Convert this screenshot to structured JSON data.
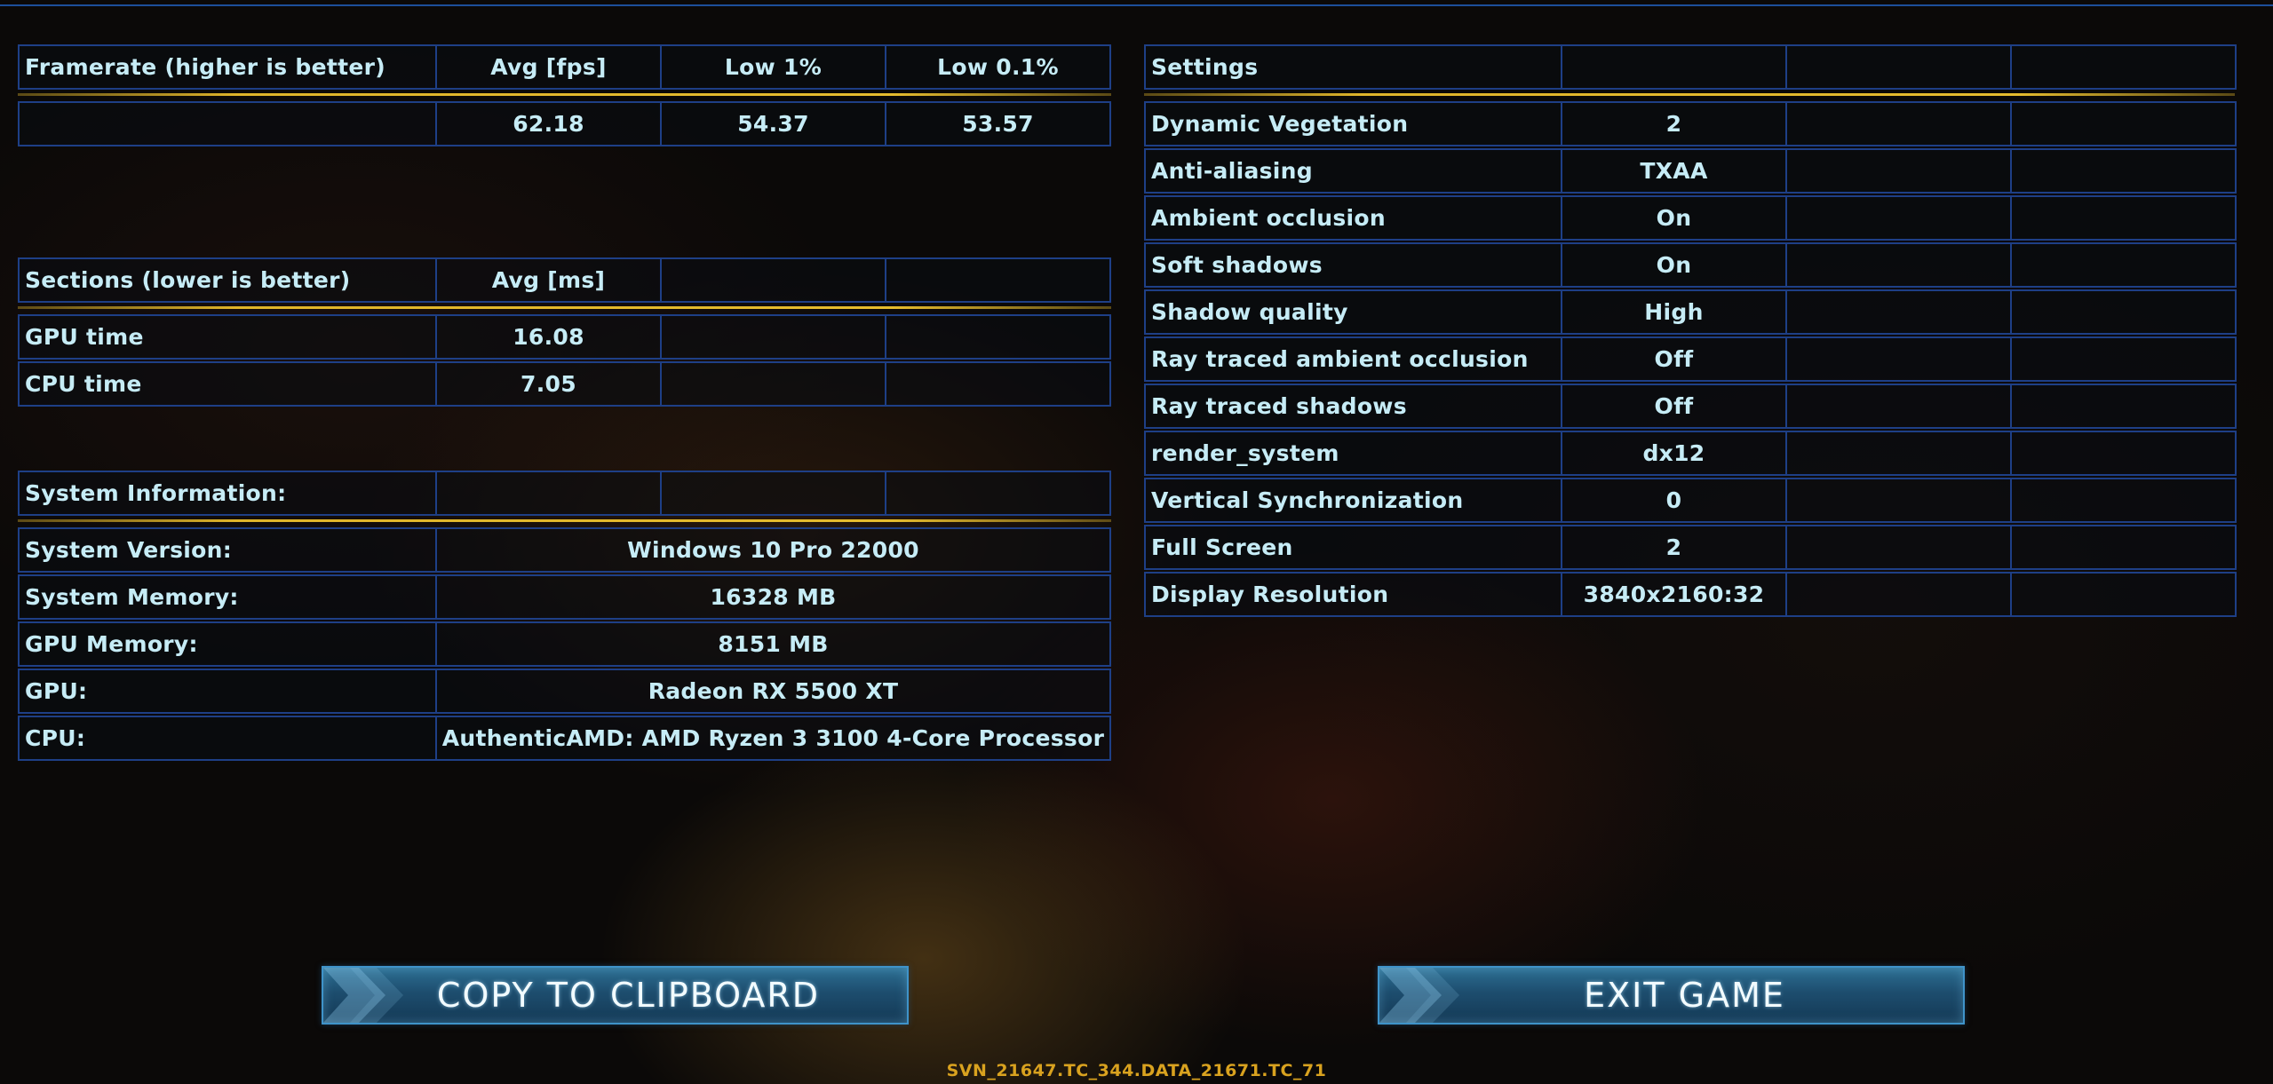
{
  "framerate": {
    "headers": [
      "Framerate (higher is better)",
      "Avg [fps]",
      "Low 1%",
      "Low 0.1%"
    ],
    "values": [
      "",
      "62.18",
      "54.37",
      "53.57"
    ]
  },
  "sections": {
    "headers": [
      "Sections (lower is better)",
      "Avg [ms]",
      "",
      ""
    ],
    "rows": [
      {
        "label": "GPU time",
        "value": "16.08"
      },
      {
        "label": "CPU time",
        "value": "7.05"
      }
    ]
  },
  "system_info": {
    "title": "System Information:",
    "rows": [
      {
        "label": "System Version:",
        "value": "Windows 10 Pro 22000"
      },
      {
        "label": "System Memory:",
        "value": "16328 MB"
      },
      {
        "label": "GPU Memory:",
        "value": "8151 MB"
      },
      {
        "label": "GPU:",
        "value": "Radeon RX 5500 XT"
      },
      {
        "label": "CPU:",
        "value": "AuthenticAMD: AMD Ryzen 3 3100 4-Core Processor"
      }
    ]
  },
  "settings": {
    "title": "Settings",
    "rows": [
      {
        "label": "Dynamic Vegetation",
        "value": "2"
      },
      {
        "label": "Anti-aliasing",
        "value": "TXAA"
      },
      {
        "label": "Ambient occlusion",
        "value": "On"
      },
      {
        "label": "Soft shadows",
        "value": "On"
      },
      {
        "label": "Shadow quality",
        "value": "High"
      },
      {
        "label": "Ray traced ambient occlusion",
        "value": "Off"
      },
      {
        "label": "Ray traced shadows",
        "value": "Off"
      },
      {
        "label": "render_system",
        "value": "dx12"
      },
      {
        "label": "Vertical Synchronization",
        "value": "0"
      },
      {
        "label": "Full Screen",
        "value": "2"
      },
      {
        "label": "Display Resolution",
        "value": "3840x2160:32"
      }
    ]
  },
  "buttons": {
    "copy_label": "COPY TO CLIPBOARD",
    "exit_label": "EXIT GAME"
  },
  "build_string": "SVN_21647.TC_344.DATA_21671.TC_71",
  "colors": {
    "accent_gold": "#e0b52a",
    "grid_border": "#1e3f86",
    "text": "#c6ecf6",
    "button": "#1d4d6e"
  }
}
